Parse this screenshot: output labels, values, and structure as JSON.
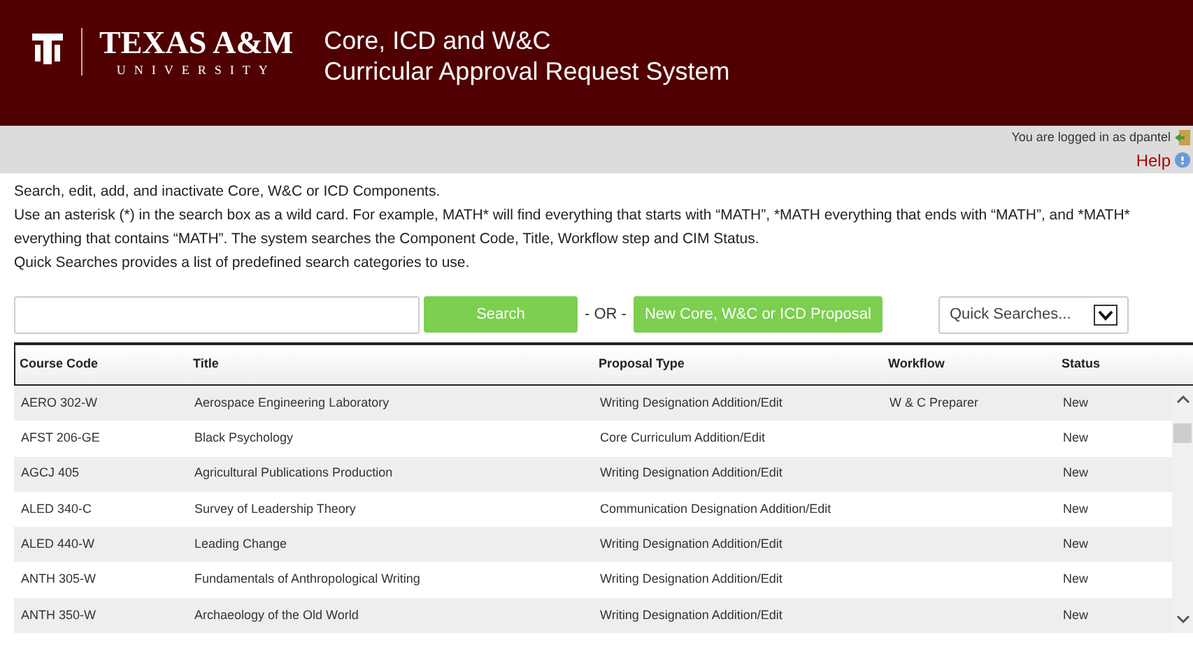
{
  "header": {
    "brand": "TEXAS A&M",
    "brand_sub": "UNIVERSITY",
    "title_line1": "Core, ICD and W&C",
    "title_line2": "Curricular Approval Request System"
  },
  "user_bar": {
    "login_text": "You are logged in as dpantel",
    "help": "Help"
  },
  "instructions": [
    "Search, edit, add, and inactivate Core, W&C or ICD Components.",
    "Use an asterisk (*) in the search box as a wild card. For example, MATH* will find everything that starts with “MATH”, *MATH everything that ends with “MATH”, and *MATH* everything that contains “MATH”. The system searches the Component Code, Title, Workflow step and CIM Status.",
    "Quick Searches provides a list of predefined search categories to use."
  ],
  "search": {
    "button": "Search",
    "separator": "- OR -",
    "new_button": "New Core, W&C or ICD Proposal",
    "quick_searches": "Quick Searches..."
  },
  "table": {
    "columns": [
      "Course Code",
      "Title",
      "Proposal Type",
      "Workflow",
      "Status"
    ],
    "rows": [
      [
        "AERO 302-W",
        "Aerospace Engineering Laboratory",
        "Writing Designation Addition/Edit",
        "W & C Preparer",
        "New"
      ],
      [
        "AFST 206-GE",
        "Black Psychology",
        "Core Curriculum Addition/Edit",
        "",
        "New"
      ],
      [
        "AGCJ 405",
        "Agricultural Publications Production",
        "Writing Designation Addition/Edit",
        "",
        "New"
      ],
      [
        "ALED 340-C",
        "Survey of Leadership Theory",
        "Communication Designation Addition/Edit",
        "",
        "New"
      ],
      [
        "ALED 440-W",
        "Leading Change",
        "Writing Designation Addition/Edit",
        "",
        "New"
      ],
      [
        "ANTH 305-W",
        "Fundamentals of Anthropological Writing",
        "Writing Designation Addition/Edit",
        "",
        "New"
      ],
      [
        "ANTH 350-W",
        "Archaeology of the Old World",
        "Writing Designation Addition/Edit",
        "",
        "New"
      ]
    ]
  }
}
